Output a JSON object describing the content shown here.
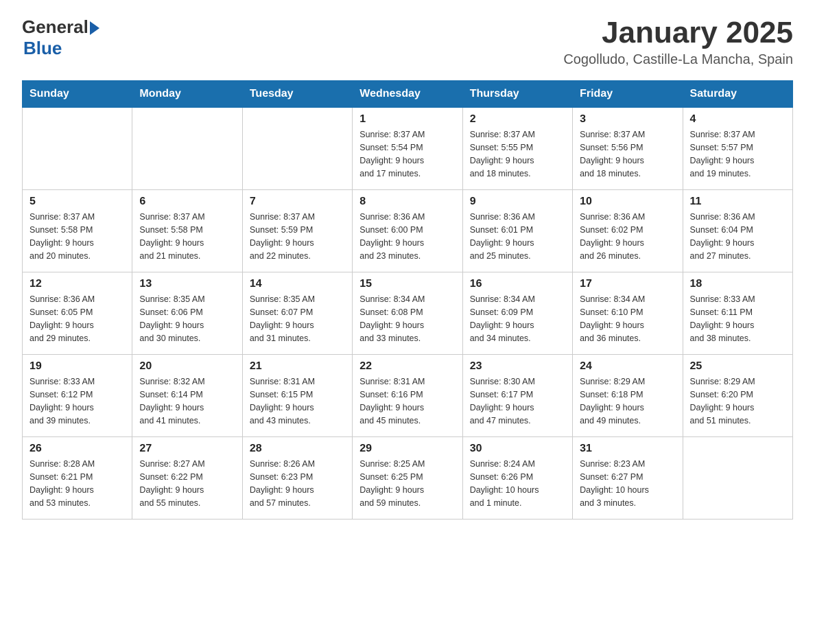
{
  "header": {
    "logo_general": "General",
    "logo_blue": "Blue",
    "title": "January 2025",
    "subtitle": "Cogolludo, Castille-La Mancha, Spain"
  },
  "weekdays": [
    "Sunday",
    "Monday",
    "Tuesday",
    "Wednesday",
    "Thursday",
    "Friday",
    "Saturday"
  ],
  "weeks": [
    [
      {
        "day": "",
        "info": ""
      },
      {
        "day": "",
        "info": ""
      },
      {
        "day": "",
        "info": ""
      },
      {
        "day": "1",
        "info": "Sunrise: 8:37 AM\nSunset: 5:54 PM\nDaylight: 9 hours\nand 17 minutes."
      },
      {
        "day": "2",
        "info": "Sunrise: 8:37 AM\nSunset: 5:55 PM\nDaylight: 9 hours\nand 18 minutes."
      },
      {
        "day": "3",
        "info": "Sunrise: 8:37 AM\nSunset: 5:56 PM\nDaylight: 9 hours\nand 18 minutes."
      },
      {
        "day": "4",
        "info": "Sunrise: 8:37 AM\nSunset: 5:57 PM\nDaylight: 9 hours\nand 19 minutes."
      }
    ],
    [
      {
        "day": "5",
        "info": "Sunrise: 8:37 AM\nSunset: 5:58 PM\nDaylight: 9 hours\nand 20 minutes."
      },
      {
        "day": "6",
        "info": "Sunrise: 8:37 AM\nSunset: 5:58 PM\nDaylight: 9 hours\nand 21 minutes."
      },
      {
        "day": "7",
        "info": "Sunrise: 8:37 AM\nSunset: 5:59 PM\nDaylight: 9 hours\nand 22 minutes."
      },
      {
        "day": "8",
        "info": "Sunrise: 8:36 AM\nSunset: 6:00 PM\nDaylight: 9 hours\nand 23 minutes."
      },
      {
        "day": "9",
        "info": "Sunrise: 8:36 AM\nSunset: 6:01 PM\nDaylight: 9 hours\nand 25 minutes."
      },
      {
        "day": "10",
        "info": "Sunrise: 8:36 AM\nSunset: 6:02 PM\nDaylight: 9 hours\nand 26 minutes."
      },
      {
        "day": "11",
        "info": "Sunrise: 8:36 AM\nSunset: 6:04 PM\nDaylight: 9 hours\nand 27 minutes."
      }
    ],
    [
      {
        "day": "12",
        "info": "Sunrise: 8:36 AM\nSunset: 6:05 PM\nDaylight: 9 hours\nand 29 minutes."
      },
      {
        "day": "13",
        "info": "Sunrise: 8:35 AM\nSunset: 6:06 PM\nDaylight: 9 hours\nand 30 minutes."
      },
      {
        "day": "14",
        "info": "Sunrise: 8:35 AM\nSunset: 6:07 PM\nDaylight: 9 hours\nand 31 minutes."
      },
      {
        "day": "15",
        "info": "Sunrise: 8:34 AM\nSunset: 6:08 PM\nDaylight: 9 hours\nand 33 minutes."
      },
      {
        "day": "16",
        "info": "Sunrise: 8:34 AM\nSunset: 6:09 PM\nDaylight: 9 hours\nand 34 minutes."
      },
      {
        "day": "17",
        "info": "Sunrise: 8:34 AM\nSunset: 6:10 PM\nDaylight: 9 hours\nand 36 minutes."
      },
      {
        "day": "18",
        "info": "Sunrise: 8:33 AM\nSunset: 6:11 PM\nDaylight: 9 hours\nand 38 minutes."
      }
    ],
    [
      {
        "day": "19",
        "info": "Sunrise: 8:33 AM\nSunset: 6:12 PM\nDaylight: 9 hours\nand 39 minutes."
      },
      {
        "day": "20",
        "info": "Sunrise: 8:32 AM\nSunset: 6:14 PM\nDaylight: 9 hours\nand 41 minutes."
      },
      {
        "day": "21",
        "info": "Sunrise: 8:31 AM\nSunset: 6:15 PM\nDaylight: 9 hours\nand 43 minutes."
      },
      {
        "day": "22",
        "info": "Sunrise: 8:31 AM\nSunset: 6:16 PM\nDaylight: 9 hours\nand 45 minutes."
      },
      {
        "day": "23",
        "info": "Sunrise: 8:30 AM\nSunset: 6:17 PM\nDaylight: 9 hours\nand 47 minutes."
      },
      {
        "day": "24",
        "info": "Sunrise: 8:29 AM\nSunset: 6:18 PM\nDaylight: 9 hours\nand 49 minutes."
      },
      {
        "day": "25",
        "info": "Sunrise: 8:29 AM\nSunset: 6:20 PM\nDaylight: 9 hours\nand 51 minutes."
      }
    ],
    [
      {
        "day": "26",
        "info": "Sunrise: 8:28 AM\nSunset: 6:21 PM\nDaylight: 9 hours\nand 53 minutes."
      },
      {
        "day": "27",
        "info": "Sunrise: 8:27 AM\nSunset: 6:22 PM\nDaylight: 9 hours\nand 55 minutes."
      },
      {
        "day": "28",
        "info": "Sunrise: 8:26 AM\nSunset: 6:23 PM\nDaylight: 9 hours\nand 57 minutes."
      },
      {
        "day": "29",
        "info": "Sunrise: 8:25 AM\nSunset: 6:25 PM\nDaylight: 9 hours\nand 59 minutes."
      },
      {
        "day": "30",
        "info": "Sunrise: 8:24 AM\nSunset: 6:26 PM\nDaylight: 10 hours\nand 1 minute."
      },
      {
        "day": "31",
        "info": "Sunrise: 8:23 AM\nSunset: 6:27 PM\nDaylight: 10 hours\nand 3 minutes."
      },
      {
        "day": "",
        "info": ""
      }
    ]
  ]
}
